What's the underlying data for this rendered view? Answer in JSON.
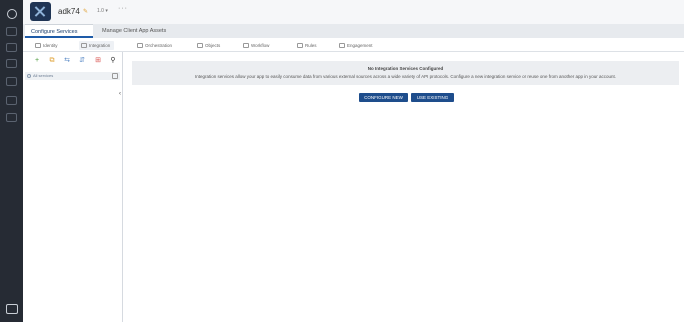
{
  "header": {
    "app_name": "adk74",
    "version": "1.0 ▾",
    "more": "···"
  },
  "tabs": [
    {
      "label": "Configure Services"
    },
    {
      "label": "Manage Client App Assets"
    }
  ],
  "subtabs": [
    {
      "label": "Identity"
    },
    {
      "label": "Integration"
    },
    {
      "label": "Orchestration"
    },
    {
      "label": "Objects"
    },
    {
      "label": "Workflow"
    },
    {
      "label": "Rules"
    },
    {
      "label": "Engagement"
    }
  ],
  "sidebar": {
    "tools": [
      "+",
      "⧉",
      "⇆",
      "⇵",
      "⊞",
      "⚲"
    ],
    "item_label": "All services"
  },
  "main": {
    "title": "No Integration Services Configured",
    "text": "Integration services allow your app to easily consume data from various external sources across a wide variety of API protocols. Configure a new integration service or reuse one from another app in your account.",
    "configure_label": "CONFIGURE NEW",
    "use_existing_label": "USE EXISTING"
  },
  "colors": {
    "rail": "#262b34",
    "accent": "#1e4d8c"
  }
}
